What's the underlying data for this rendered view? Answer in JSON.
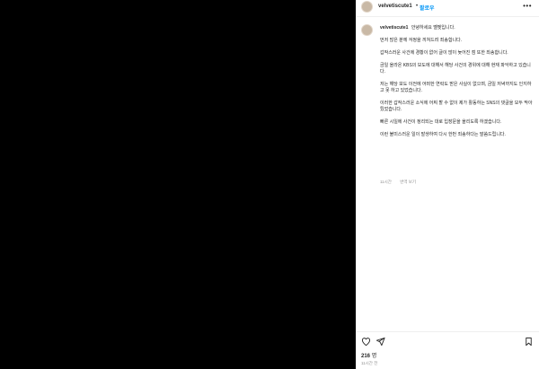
{
  "header": {
    "username": "velvetiscute1",
    "dot": "•",
    "follow_label": "팔로우",
    "more_label": "•••"
  },
  "caption": {
    "username": "velvetiscute1",
    "first_line": "안녕하세요 벨벳입니다.",
    "paragraphs": [
      "먼저 많은 분께 걱정을 끼쳐드려 죄송합니다.",
      "갑작스러운 사건에 경황이 없어 글이 많이 늦어진 점 또한 죄송합니다.",
      "금일 올라온 KBS의 보도에 대해서 해당 사건의 경위에 대해 현재 파악하고 있습니다.",
      "저는 해당 보도 이전에 어떠한 연락도 받은 사실이 없으며, 금일 저녁까지도 인지하고 못 하고 있었습니다.",
      "이러한 갑작스러운 소식에 어찌 할 수 없이 제가 활동하는 SNS의 댓글을 모두 막아뒀었습니다.",
      "빠른 시일에 사건이 정리되는 대로 입장문을 올리도록 하겠습니다.",
      "이런 불미스러운 일이 발생하여 다시 한번 죄송하다는 말씀드립니다."
    ],
    "time": "11시간",
    "see_translation": "번역 보기"
  },
  "actions": {
    "like_icon": "heart-icon",
    "share_icon": "send-icon",
    "save_icon": "bookmark-icon"
  },
  "likes": {
    "count": "216",
    "label": "명"
  },
  "posted_time": "11시간 전"
}
